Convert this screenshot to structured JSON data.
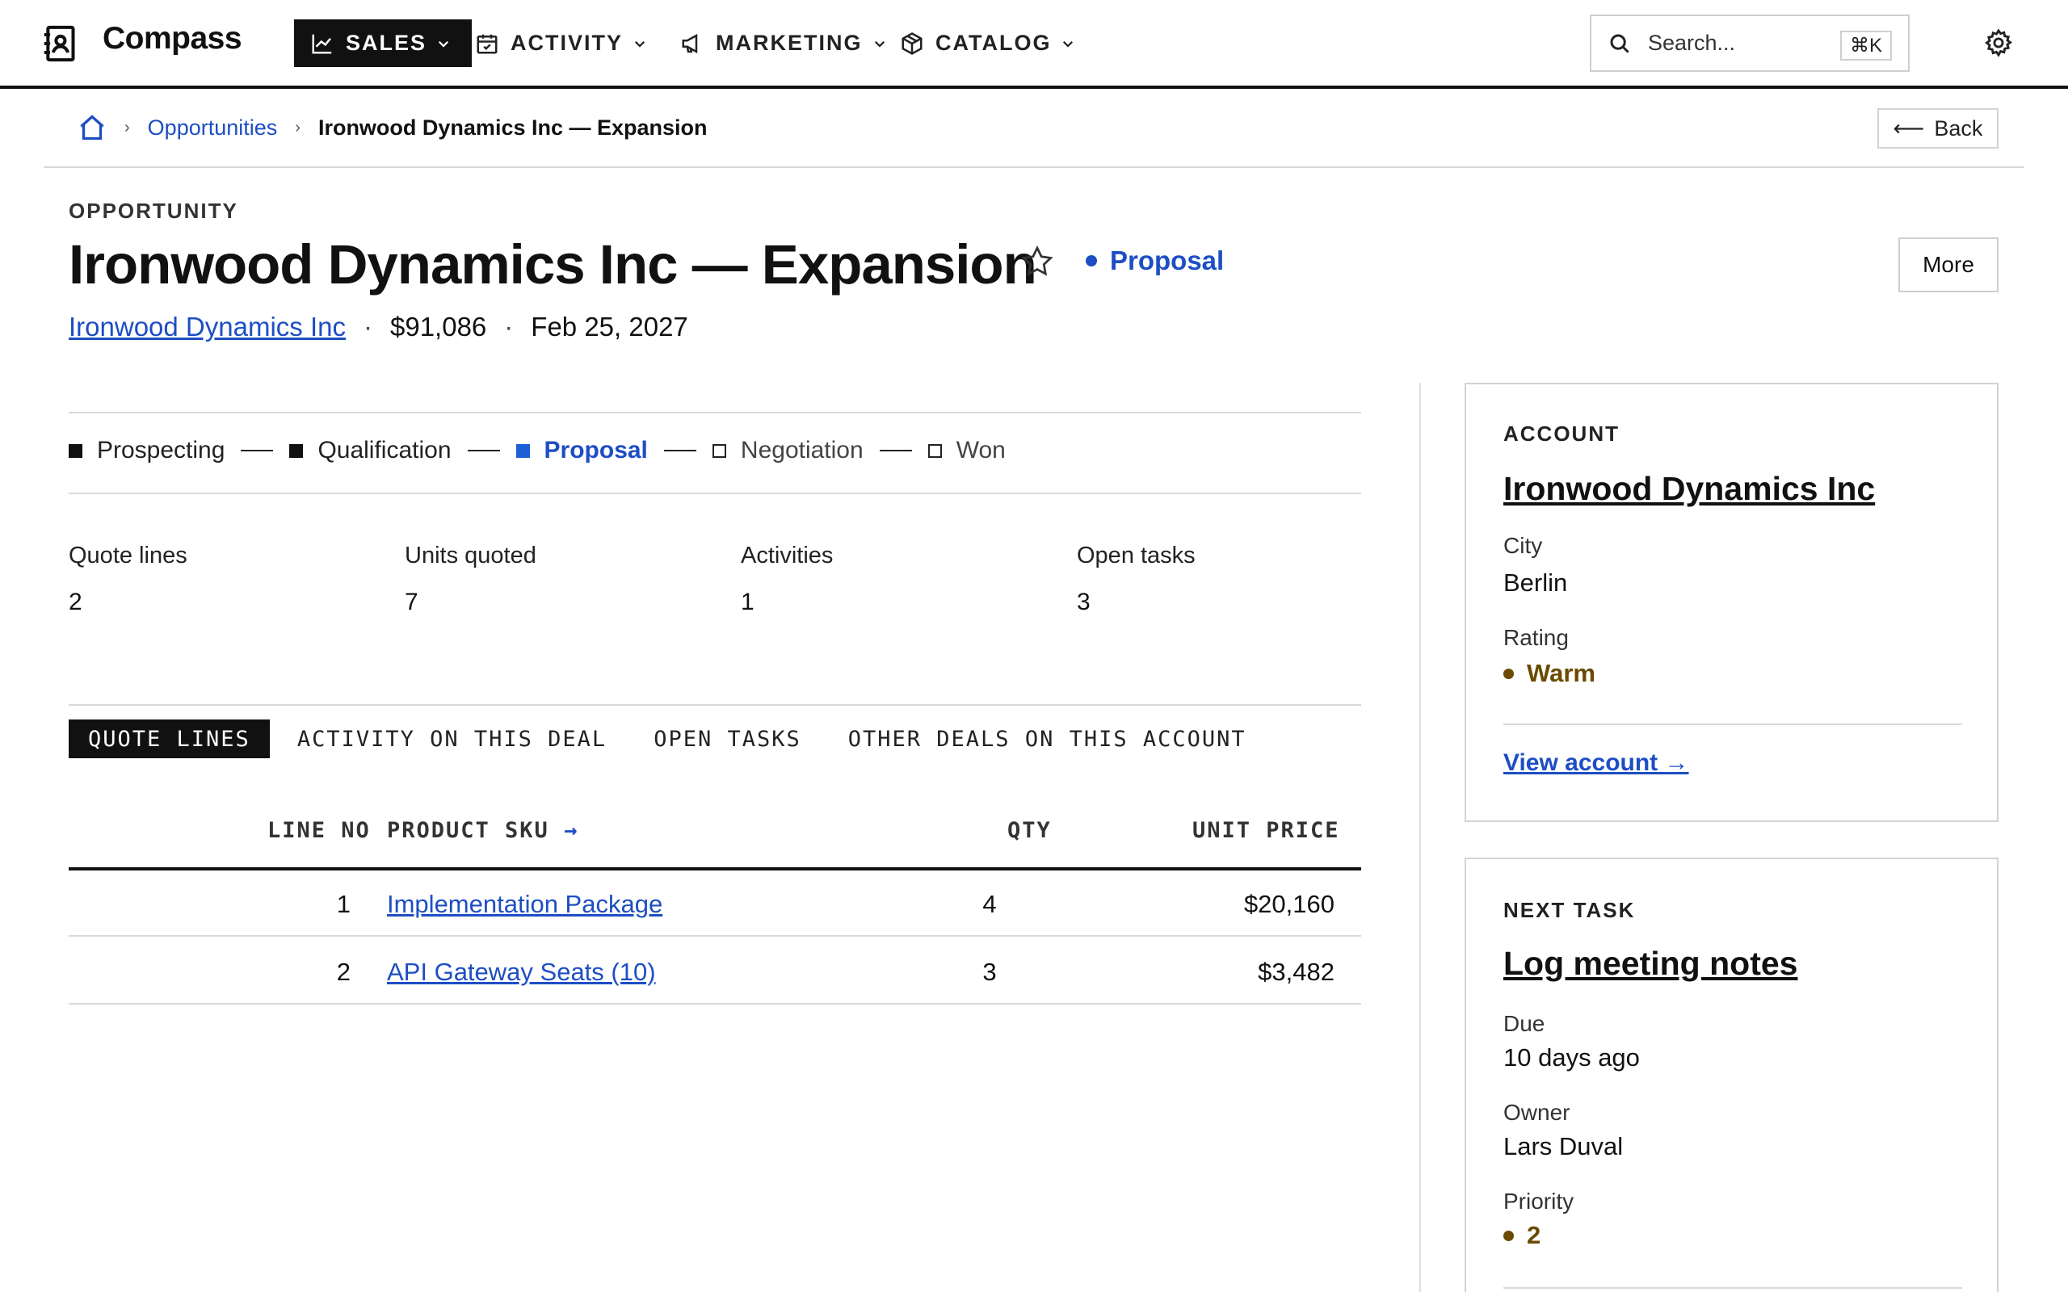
{
  "app": {
    "name": "Compass"
  },
  "nav": {
    "items": [
      {
        "label": "SALES",
        "icon": "chart-line-icon",
        "active": true
      },
      {
        "label": "ACTIVITY",
        "icon": "calendar-icon",
        "active": false
      },
      {
        "label": "MARKETING",
        "icon": "megaphone-icon",
        "active": false
      },
      {
        "label": "CATALOG",
        "icon": "package-icon",
        "active": false
      }
    ],
    "search_placeholder": "Search...",
    "search_shortcut": "⌘K"
  },
  "breadcrumb": {
    "items": [
      "Opportunities",
      "Ironwood Dynamics Inc — Expansion"
    ],
    "back_label": "Back"
  },
  "header": {
    "eyebrow": "OPPORTUNITY",
    "title": "Ironwood Dynamics Inc — Expansion",
    "stage": "Proposal",
    "more_label": "More",
    "account": "Ironwood Dynamics Inc",
    "amount": "$91,086",
    "close_date": "Feb 25, 2027"
  },
  "stages": [
    {
      "label": "Prospecting",
      "state": "done"
    },
    {
      "label": "Qualification",
      "state": "done"
    },
    {
      "label": "Proposal",
      "state": "current"
    },
    {
      "label": "Negotiation",
      "state": "future"
    },
    {
      "label": "Won",
      "state": "future"
    }
  ],
  "stats": [
    {
      "label": "Quote lines",
      "value": "2"
    },
    {
      "label": "Units quoted",
      "value": "7"
    },
    {
      "label": "Activities",
      "value": "1"
    },
    {
      "label": "Open tasks",
      "value": "3"
    }
  ],
  "tabs": [
    "QUOTE LINES",
    "ACTIVITY ON THIS DEAL",
    "OPEN TASKS",
    "OTHER DEALS ON THIS ACCOUNT"
  ],
  "table": {
    "columns": [
      "LINE NO",
      "PRODUCT SKU",
      "QTY",
      "UNIT PRICE"
    ],
    "sort_arrow": "→",
    "rows": [
      {
        "line": "1",
        "product": "Implementation Package",
        "qty": "4",
        "price": "$20,160"
      },
      {
        "line": "2",
        "product": "API Gateway Seats (10)",
        "qty": "3",
        "price": "$3,482"
      }
    ]
  },
  "account_card": {
    "caption": "ACCOUNT",
    "name": "Ironwood Dynamics Inc",
    "city_label": "City",
    "city": "Berlin",
    "rating_label": "Rating",
    "rating": "Warm",
    "link": "View account →"
  },
  "task_card": {
    "caption": "NEXT TASK",
    "title": "Log meeting notes",
    "due_label": "Due",
    "due": "10 days ago",
    "owner_label": "Owner",
    "owner": "Lars Duval",
    "priority_label": "Priority",
    "priority": "2"
  },
  "colors": {
    "accent": "#1d4ec4",
    "warm": "#6b4a00",
    "ink": "#111111"
  }
}
